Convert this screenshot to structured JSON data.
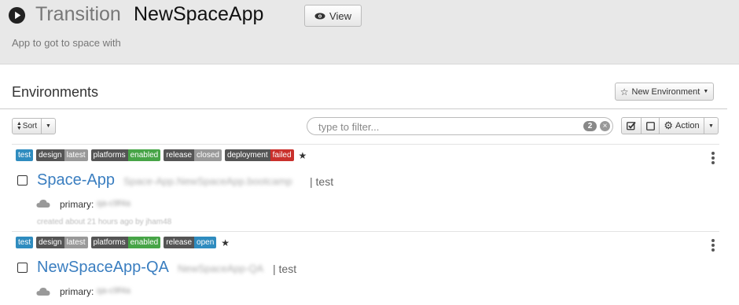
{
  "header": {
    "title_prefix": "Transition",
    "title_app": "NewSpaceApp",
    "view_label": "View",
    "subtitle": "App to got to space with"
  },
  "environments": {
    "title": "Environments",
    "new_button_label": "New Environment",
    "sort_label": "Sort",
    "filter_placeholder": "type to filter...",
    "filter_count": "2",
    "action_label": "Action"
  },
  "items": [
    {
      "tags": [
        {
          "single": "test"
        },
        {
          "key": "design",
          "value": "latest",
          "color": "#999999"
        },
        {
          "key": "platforms",
          "value": "enabled",
          "color": "#47a447"
        },
        {
          "key": "release",
          "value": "closed",
          "color": "#999999"
        },
        {
          "key": "deployment",
          "value": "failed",
          "color": "#c9302c"
        }
      ],
      "name": "Space-App",
      "host": "Space-App.NewSpaceApp.bootcamp",
      "env_type": "test",
      "primary_label": "primary:",
      "primary_value": "qa-c9f4a",
      "created": "created about 21 hours ago by jham48"
    },
    {
      "tags": [
        {
          "single": "test"
        },
        {
          "key": "design",
          "value": "latest",
          "color": "#999999"
        },
        {
          "key": "platforms",
          "value": "enabled",
          "color": "#47a447"
        },
        {
          "key": "release",
          "value": "open",
          "color": "#2f8cbf"
        }
      ],
      "name": "NewSpaceApp-QA",
      "host": "NewSpaceApp-QA",
      "env_type": "test",
      "primary_label": "primary:",
      "primary_value": "qa-c9f4a"
    }
  ]
}
